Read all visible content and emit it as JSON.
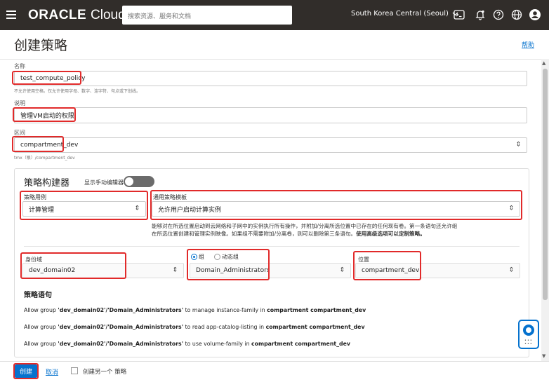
{
  "header": {
    "logo_brand": "ORACLE",
    "logo_product": "Cloud",
    "search_placeholder": "搜索资源、服务和文档",
    "region": "South Korea Central (Seoul)"
  },
  "page": {
    "title": "创建策略",
    "help_link": "帮助"
  },
  "form": {
    "name_label": "名称",
    "name_value": "test_compute_policy",
    "name_hint": "不允许使用空格。仅允许使用字母、数字、连字符、句点或下划线。",
    "description_label": "说明",
    "description_value": "管理VM启动的权限",
    "compartment_label": "区间",
    "compartment_value": "compartment_dev",
    "compartment_path": "tmx（根）/compartment_dev"
  },
  "builder": {
    "title": "策略构建器",
    "manual_editor_label": "显示手动编辑器",
    "use_case_label": "策略用例",
    "use_case_value": "计算管理",
    "template_label": "通用策略模板",
    "template_value": "允许用户启动计算实例",
    "template_desc_line1": "能够对在所选位置启动到云网络和子网中的实例执行所有操作，并附加/分离所选位置中已存在的任何现有卷。第一条语句还允许组",
    "template_desc_line2_plain": "在所选位置创建和管理实例映像。如果组不需要附加/分离卷，则可以删除第三条语句。",
    "template_desc_line2_bold": "使用高级选项可以定制策略。",
    "identity_domain_label": "身份域",
    "identity_domain_value": "dev_domain02",
    "group_radio_label": "组",
    "dynamic_group_radio_label": "动态组",
    "group_value": "Domain_Administrators",
    "location_label": "位置",
    "location_value": "compartment_dev",
    "statements_heading": "策略语句",
    "statements": [
      {
        "pre": "Allow group ",
        "group": "'dev_domain02'/'Domain_Administrators'",
        "mid": " to manage instance-family in ",
        "target": "compartment compartment_dev"
      },
      {
        "pre": "Allow group ",
        "group": "'dev_domain02'/'Domain_Administrators'",
        "mid": " to read app-catalog-listing in ",
        "target": "compartment compartment_dev"
      },
      {
        "pre": "Allow group ",
        "group": "'dev_domain02'/'Domain_Administrators'",
        "mid": " to use volume-family in ",
        "target": "compartment compartment_dev"
      }
    ]
  },
  "footer": {
    "create_label": "创建",
    "cancel_label": "取消",
    "create_another_label": "创建另一个 策略"
  },
  "colors": {
    "topbar": "#312d2a",
    "accent": "#0572ce",
    "highlight": "#e12a2a"
  }
}
